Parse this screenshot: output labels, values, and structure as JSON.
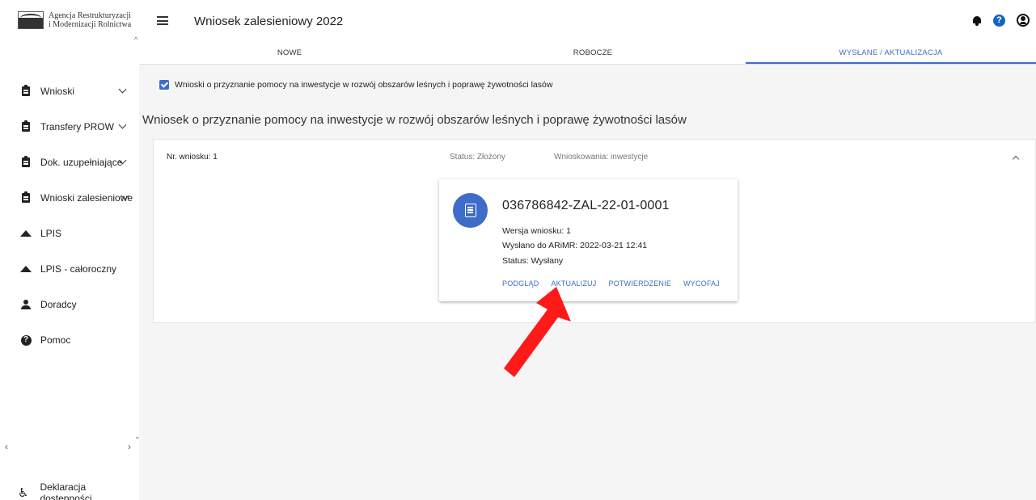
{
  "brand": {
    "line1": "Agencja Restrukturyzacji",
    "line2": "i Modernizacji Rolnictwa"
  },
  "sidebar": {
    "items": [
      {
        "label": "Wnioski",
        "icon": "clipboard-icon",
        "expandable": true
      },
      {
        "label": "Transfery PROW",
        "icon": "clipboard-icon",
        "expandable": true
      },
      {
        "label": "Dok. uzupełniające",
        "icon": "clipboard-icon",
        "expandable": true
      },
      {
        "label": "Wnioski zalesieniowe",
        "icon": "clipboard-icon",
        "expandable": true
      },
      {
        "label": "LPIS",
        "icon": "terrain-icon",
        "expandable": false
      },
      {
        "label": "LPIS - całoroczny",
        "icon": "terrain-icon",
        "expandable": false
      },
      {
        "label": "Doradcy",
        "icon": "person-icon",
        "expandable": false
      },
      {
        "label": "Pomoc",
        "icon": "help-icon",
        "expandable": false
      }
    ],
    "accessibility_label": "Deklaracja dostępności"
  },
  "header": {
    "title": "Wniosek zalesieniowy 2022"
  },
  "tabs": [
    {
      "label": "NOWE",
      "active": false
    },
    {
      "label": "ROBOCZE",
      "active": false
    },
    {
      "label": "WYSŁANE / AKTUALIZACJA",
      "active": true
    }
  ],
  "filter": {
    "label": "Wnioski o przyznanie pomocy na inwestycje w rozwój obszarów leśnych i poprawę żywotności lasów",
    "checked": true
  },
  "section": {
    "title": "Wniosek o przyznanie pomocy na inwestycje w rozwój obszarów leśnych i poprawę żywotności lasów"
  },
  "panel": {
    "nr": "Nr. wniosku: 1",
    "status": "Status: Złożony",
    "wnioskowania": "Wnioskowania: inwestycje"
  },
  "card": {
    "id": "036786842-ZAL-22-01-0001",
    "version": "Wersja wniosku: 1",
    "sent": "Wysłano do ARiMR: 2022-03-21 12:41",
    "status": "Status: Wysłany",
    "actions": {
      "preview": "PODGLĄD",
      "update": "AKTUALIZUJ",
      "confirmation": "POTWIERDZENIE",
      "withdraw": "WYCOFAJ"
    }
  },
  "colors": {
    "accent": "#3f6cc9",
    "help": "#1565c0",
    "arrow": "#ff1a1a",
    "background": "#f5f5f5"
  }
}
